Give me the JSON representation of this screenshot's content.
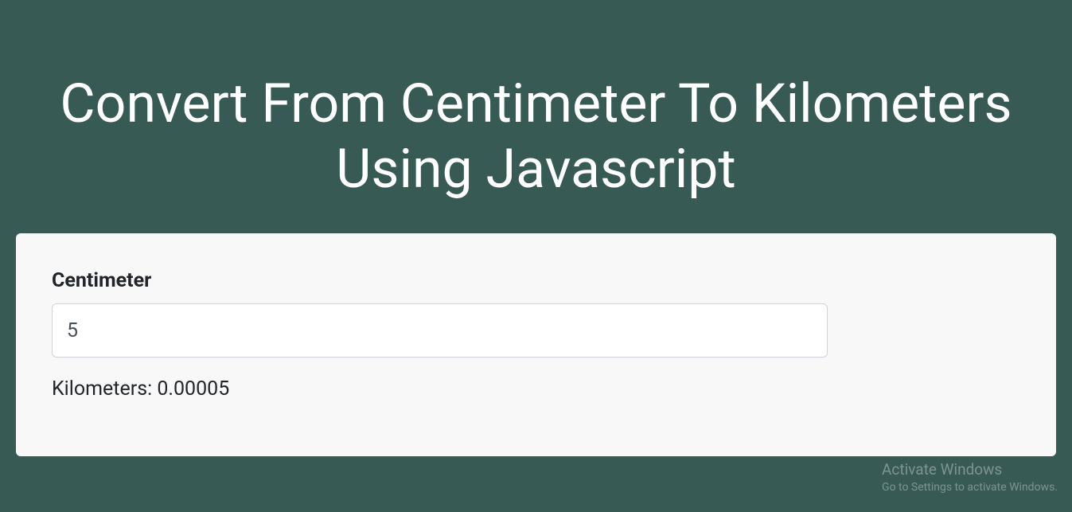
{
  "header": {
    "title": "Convert From Centimeter To Kilometers Using Javascript"
  },
  "form": {
    "label": "Centimeter",
    "input_value": "5",
    "input_placeholder": ""
  },
  "result": {
    "text": "Kilometers: 0.00005"
  },
  "watermark": {
    "line1": "Activate Windows",
    "line2": "Go to Settings to activate Windows."
  }
}
